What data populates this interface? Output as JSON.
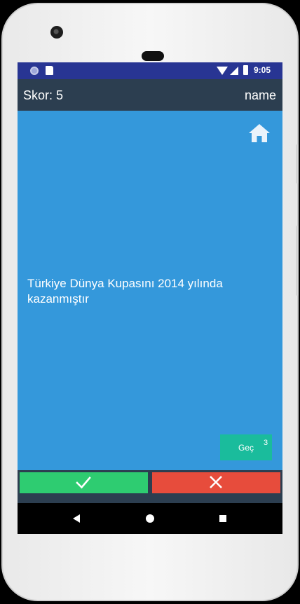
{
  "status_bar": {
    "time": "9:05",
    "icons": [
      "notification-circle-icon",
      "sd-card-icon",
      "wifi-icon",
      "signal-icon",
      "battery-icon"
    ]
  },
  "top_bar": {
    "score_text": "Skor: 5",
    "user_name": "name"
  },
  "content": {
    "question": "Türkiye Dünya Kupasını 2014 yılında kazanmıştır",
    "home_icon": "home-icon",
    "skip_button": {
      "label": "Geç",
      "count": "3"
    }
  },
  "answers": {
    "true_icon": "check-icon",
    "false_icon": "close-icon"
  },
  "nav_bar": {
    "icons": [
      "back-icon",
      "home-circle-icon",
      "recents-icon"
    ]
  },
  "colors": {
    "status_bar": "#283593",
    "top_bar": "#2c3e50",
    "content_background": "#3498db",
    "skip_button": "#1abc9c",
    "true_button": "#2ecc71",
    "false_button": "#e74c3c",
    "nav_bar": "#000000"
  }
}
